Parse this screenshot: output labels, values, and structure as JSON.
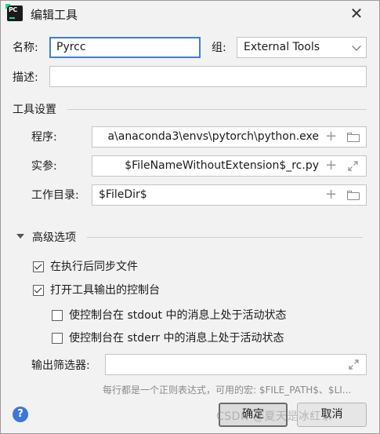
{
  "window": {
    "title": "编辑工具",
    "app_icon_text": "PC"
  },
  "form": {
    "name_label": "名称:",
    "name_value": "Pyrcc",
    "group_label": "组:",
    "group_value": "External Tools",
    "desc_label": "描述:",
    "desc_value": ""
  },
  "tool_settings": {
    "section_label": "工具设置",
    "program_label": "程序:",
    "program_value": "a\\anaconda3\\envs\\pytorch\\python.exe",
    "args_label": "实参:",
    "args_value": "$FileNameWithoutExtension$_rc.py",
    "workdir_label": "工作目录:",
    "workdir_value": "$FileDir$"
  },
  "advanced": {
    "section_label": "高级选项",
    "sync_files_label": "在执行后同步文件",
    "sync_files_checked": true,
    "open_console_label": "打开工具输出的控制台",
    "open_console_checked": true,
    "stdout_active_label": "使控制台在 stdout 中的消息上处于活动状态",
    "stdout_active_checked": false,
    "stderr_active_label": "使控制台在 stderr 中的消息上处于活动状态",
    "stderr_active_checked": false,
    "output_filters_label": "输出筛选器:",
    "output_filters_value": "",
    "output_filters_hint": "每行都是一个正则表达式，可用的宏: $FILE_PATH$、$LI..."
  },
  "footer": {
    "help_label": "?",
    "ok_label": "确定",
    "cancel_label": "取消",
    "watermark": "CSDN @夏天是冰红茶"
  },
  "colors": {
    "focus_border": "#3c7fd8",
    "help_bg": "#3b78d6",
    "app_icon_accent": "#21d789"
  }
}
